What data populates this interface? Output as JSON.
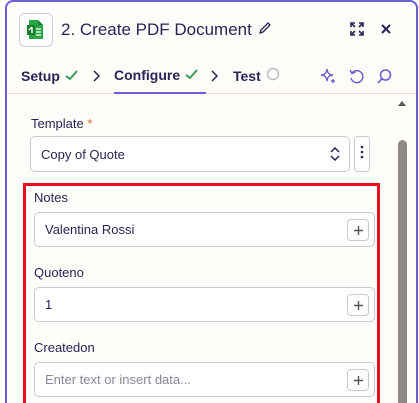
{
  "header": {
    "step_title": "2. Create PDF Document",
    "app_icon": "pdfmonkey-green-document-icon",
    "edit_icon": "pencil-icon",
    "expand_icon": "expand-arrows-icon",
    "close_icon": "close-x-icon"
  },
  "tabs": [
    {
      "label": "Setup",
      "status": "complete"
    },
    {
      "label": "Configure",
      "status": "complete"
    },
    {
      "label": "Test",
      "status": "pending"
    }
  ],
  "toolbar": {
    "ai_icon": "sparkle-icon",
    "undo_icon": "rotate-left-icon",
    "search_icon": "search-icon"
  },
  "form": {
    "template": {
      "label": "Template",
      "required_mark": "*",
      "value": "Copy of Quote"
    },
    "fields": [
      {
        "label": "Notes",
        "value": "Valentina Rossi",
        "placeholder": ""
      },
      {
        "label": "Quoteno",
        "value": "1",
        "placeholder": ""
      },
      {
        "label": "Createdon",
        "value": "",
        "placeholder": "Enter text or insert data..."
      }
    ]
  },
  "colors": {
    "accent": "#6a5fd0",
    "check": "#2d9a53",
    "highlight_border": "#e8101a",
    "required": "#e0652a"
  }
}
